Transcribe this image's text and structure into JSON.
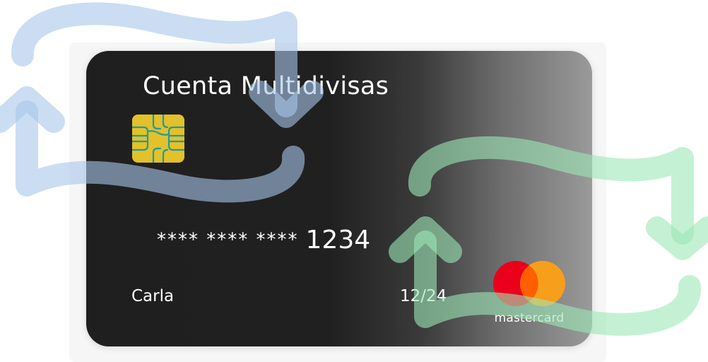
{
  "card": {
    "title": "Cuenta Multidivisas",
    "number_mask": "**** **** ****",
    "number_last4": "1234",
    "holder": "Carla",
    "expiry": "12/24",
    "brand": "mastercard"
  },
  "colors": {
    "card_dark": "#1f1f1f",
    "chip_gold": "#e2c12a",
    "chip_lines": "#1f9aa0",
    "mastercard_red": "#eb001b",
    "mastercard_orange": "#f79e1b",
    "arrow_blue": "#a9c6ea",
    "arrow_green": "#9de8b5"
  },
  "icons": {
    "chip": "emv-chip-icon",
    "brand_logo": "mastercard-logo-icon",
    "exchange_blue": "exchange-arrows-icon",
    "exchange_green": "exchange-arrows-icon"
  }
}
